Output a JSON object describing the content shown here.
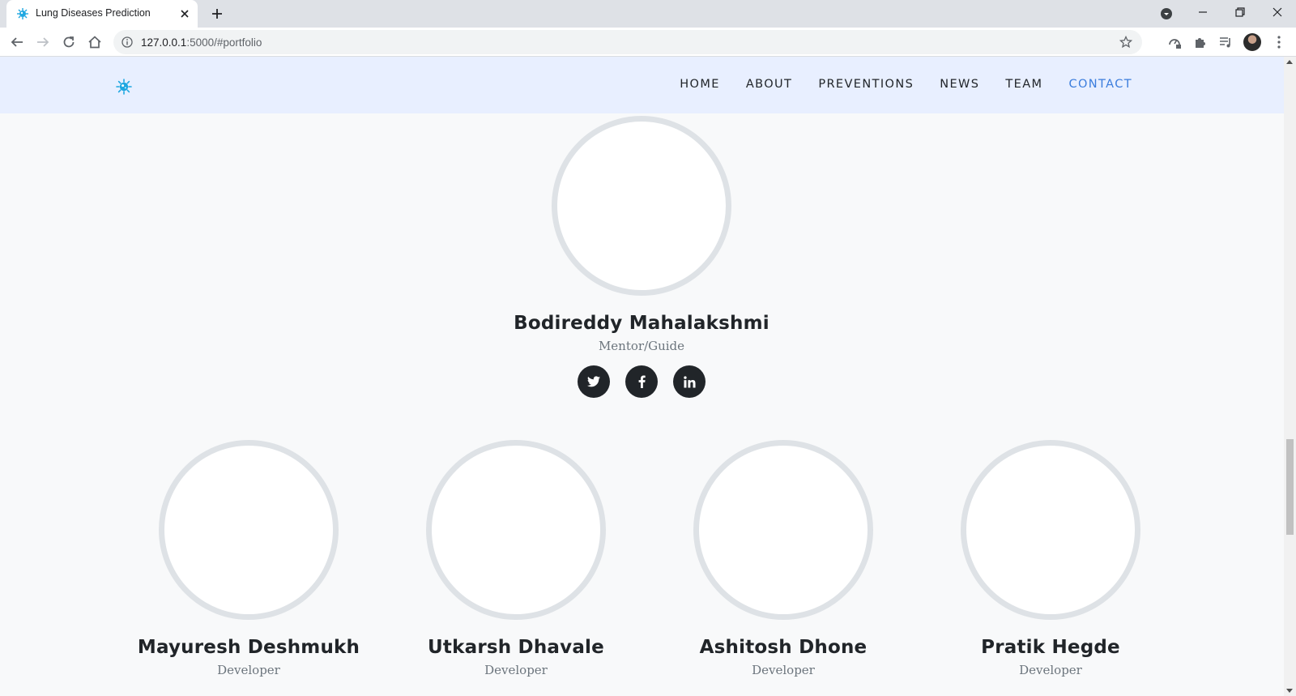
{
  "browser": {
    "tab_title": "Lung Diseases Prediction",
    "url_host": "127.0.0.1",
    "url_rest": ":5000/#portfolio"
  },
  "nav": {
    "items": [
      {
        "label": "HOME",
        "active": false
      },
      {
        "label": "ABOUT",
        "active": false
      },
      {
        "label": "PREVENTIONS",
        "active": false
      },
      {
        "label": "NEWS",
        "active": false
      },
      {
        "label": "TEAM",
        "active": false
      },
      {
        "label": "CONTACT",
        "active": true
      }
    ],
    "active_color": "#3b7ddd"
  },
  "mentor": {
    "name": "Bodireddy Mahalakshmi",
    "role": "Mentor/Guide",
    "socials": [
      "twitter-icon",
      "facebook-icon",
      "linkedin-icon"
    ]
  },
  "members": [
    {
      "name": "Mayuresh Deshmukh",
      "role": "Developer"
    },
    {
      "name": "Utkarsh Dhavale",
      "role": "Developer"
    },
    {
      "name": "Ashitosh Dhone",
      "role": "Developer"
    },
    {
      "name": "Pratik Hegde",
      "role": "Developer"
    }
  ],
  "colors": {
    "nav_background": "#e8efff",
    "page_background": "#f8f9fa",
    "social_button": "#212529"
  }
}
